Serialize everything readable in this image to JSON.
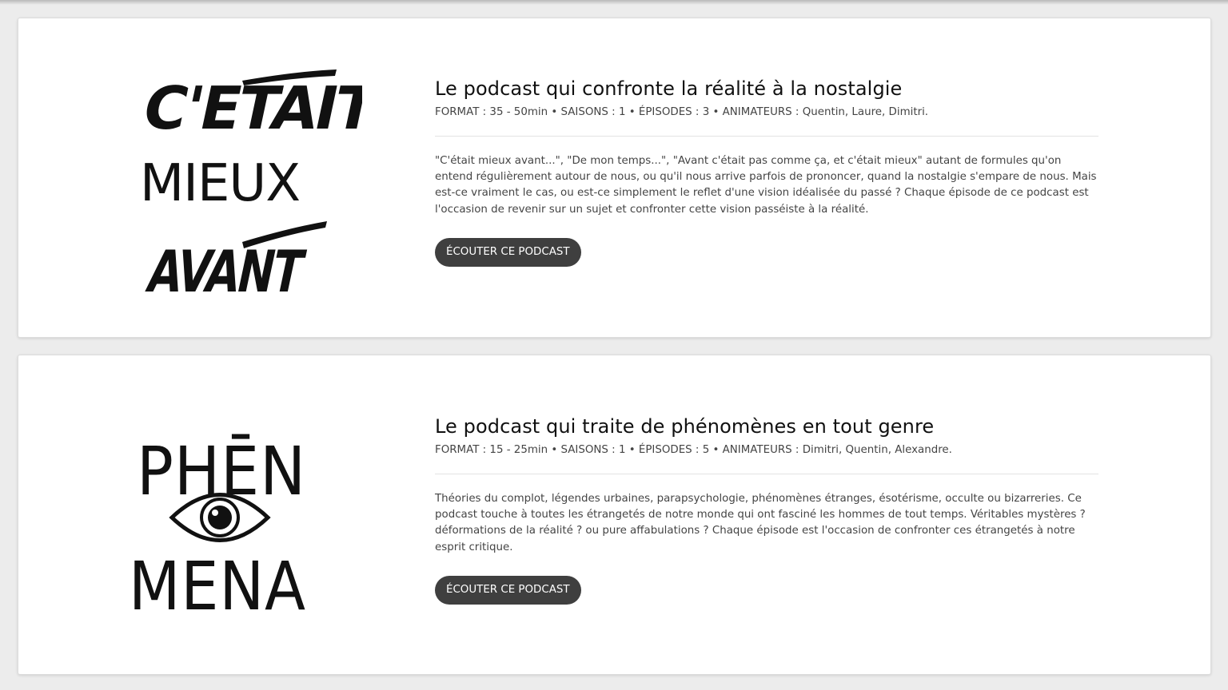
{
  "podcasts": [
    {
      "logo_lines": [
        "C'ETAIT",
        "MIEUX",
        "AVANT"
      ],
      "title": "Le podcast qui confronte la réalité à la nostalgie",
      "meta": "FORMAT : 35 - 50min • SAISONS : 1 • ÉPISODES : 3 • ANIMATEURS : Quentin, Laure, Dimitri.",
      "description": "\"C'était mieux avant...\", \"De mon temps...\", \"Avant c'était pas comme ça, et c'était mieux\" autant de formules qu'on entend régulièrement autour de nous, ou qu'il nous arrive parfois de prononcer, quand la nostalgie s'empare de nous. Mais est-ce vraiment le cas, ou est-ce simplement le reflet d'une vision idéalisée du passé ? Chaque épisode de ce podcast est l'occasion de revenir sur un sujet et confronter cette vision passéiste à la réalité.",
      "button_label": "ÉCOUTER CE PODCAST"
    },
    {
      "logo_lines": [
        "PHĒN",
        "MENA"
      ],
      "title": "Le podcast qui traite de phénomènes en tout genre",
      "meta": "FORMAT : 15 - 25min • SAISONS : 1 • ÉPISODES : 5 • ANIMATEURS : Dimitri, Quentin, Alexandre.",
      "description": "Théories du complot, légendes urbaines, parapsychologie, phénomènes étranges, ésotérisme, occulte ou bizarreries. Ce podcast touche à toutes les étrangetés de notre monde qui ont fasciné les hommes de tout temps. Véritables mystères ? déformations de la réalité ? ou pure affabulations ? Chaque épisode est l'occasion de confronter ces étrangetés à notre esprit critique.",
      "button_label": "ÉCOUTER CE PODCAST"
    }
  ],
  "colors": {
    "page_background": "#ececec",
    "card_background": "#ffffff",
    "button_background": "#3f3f3f",
    "button_text": "#ffffff"
  }
}
